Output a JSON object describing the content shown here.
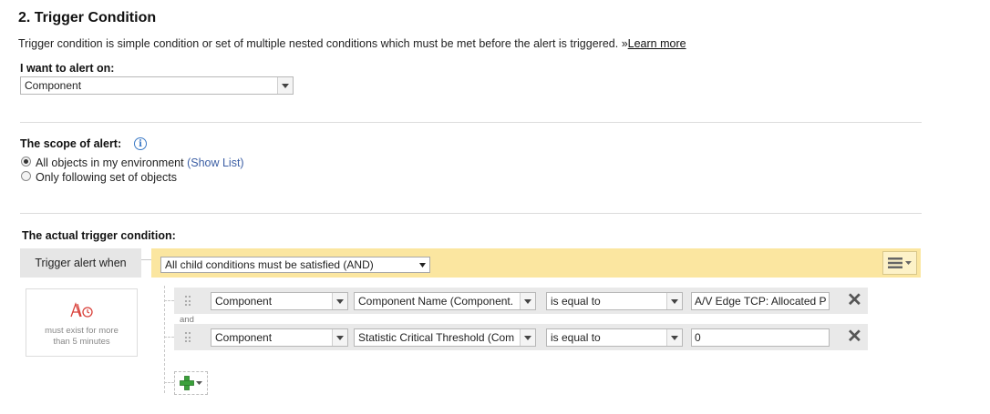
{
  "section": {
    "title": "2. Trigger Condition",
    "description": "Trigger condition is simple condition or set of multiple nested conditions which must be met before the alert is triggered.",
    "learn_more_prefix": "»",
    "learn_more": "Learn more"
  },
  "alert_on": {
    "label": "I want to alert on:",
    "value": "Component"
  },
  "scope": {
    "label": "The scope of alert:",
    "options": [
      {
        "label": "All objects in my environment",
        "selected": true,
        "link": "(Show List)"
      },
      {
        "label": "Only following set of objects",
        "selected": false
      }
    ]
  },
  "trigger": {
    "label": "The actual trigger condition:",
    "when_label": "Trigger alert when",
    "group_mode": "All child conditions must be satisfied (AND)",
    "sustain_text": "must exist for more than 5 minutes",
    "conjunction": "and",
    "conditions": [
      {
        "entity": "Component",
        "property": "Component Name (Component.",
        "operator": "is equal to",
        "value": "A/V Edge TCP: Allocated P"
      },
      {
        "entity": "Component",
        "property": "Statistic Critical Threshold (Com",
        "operator": "is equal to",
        "value": "0"
      }
    ]
  },
  "colors": {
    "condition_bar": "#fbe6a0",
    "condition_row": "#e9e9e9",
    "link": "#3b5ea4",
    "add_icon": "#3aa03a",
    "timer_icon": "#d9413a"
  },
  "icons": {
    "info": "info-circle-icon",
    "menu": "hamburger-menu-icon",
    "remove": "close-x-icon",
    "add": "green-plus-icon",
    "drag": "drag-grip-icon",
    "timer": "time-condition-icon"
  }
}
